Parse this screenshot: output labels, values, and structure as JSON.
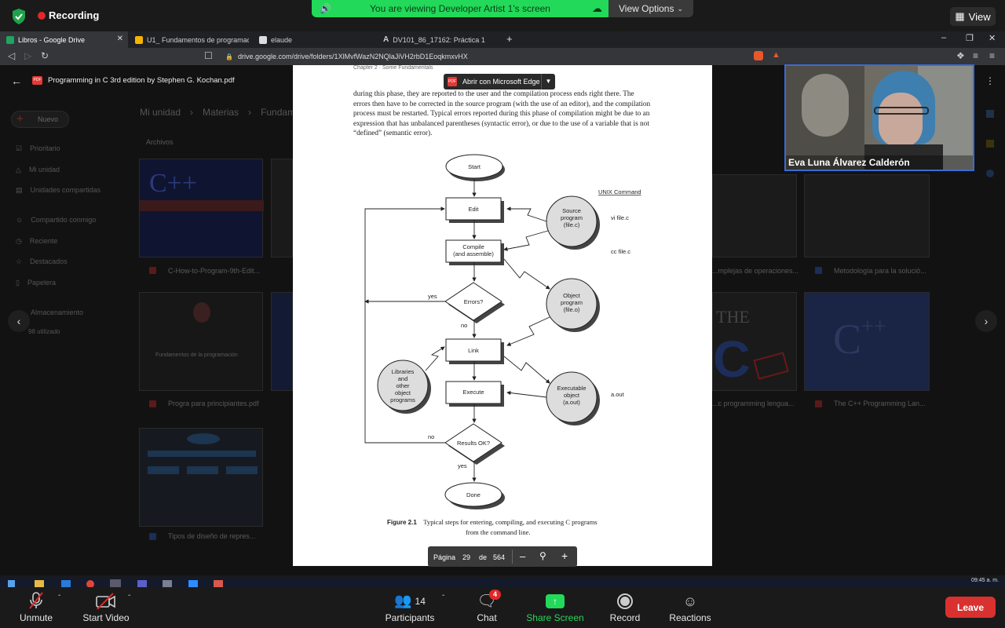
{
  "zoom": {
    "recording_label": "Recording",
    "viewing_text": "You are viewing Developer Artist 1's screen",
    "view_options": "View Options",
    "view_button": "View",
    "participant_name": "Eva Luna Álvarez Calderón",
    "bottom": {
      "unmute": "Unmute",
      "start_video": "Start Video",
      "participants": "Participants",
      "participants_count": "14",
      "chat": "Chat",
      "chat_badge": "4",
      "share_screen": "Share Screen",
      "record": "Record",
      "reactions": "Reactions",
      "leave": "Leave"
    }
  },
  "browser": {
    "tabs": [
      {
        "label": "Libros - Google Drive"
      },
      {
        "label": "U1_ Fundamentos de programación.p"
      },
      {
        "label": "elaude"
      },
      {
        "label": "DV101_86_17162: Práctica 1"
      }
    ],
    "url": "drive.google.com/drive/folders/1XlMvfWazN2NQlaJiVH2rbD1EoqkmxvHX"
  },
  "drive": {
    "file_title": "Programming in C 3rd edition by Stephen G. Kochan.pdf",
    "new_button": "Nuevo",
    "nav": [
      "Prioritario",
      "Mi unidad",
      "Unidades compartidas",
      "Compartido conmigo",
      "Reciente",
      "Destacados",
      "Papelera",
      "Almacenamiento"
    ],
    "storage": "98 utilizado",
    "breadcrumb": [
      "Mi unidad",
      "Materias",
      "Fundam"
    ],
    "section": "Archivos",
    "files": [
      "C-How-to-Program-9th-Edit...",
      "Fundamentos de la programación",
      "Progra para principiantes.pdf",
      "Tipos de diseño de repres...",
      "...mplejas de operaciones...",
      "Metodología para la solució...",
      "...c programming lengua...",
      "The C++ Programming Lan..."
    ],
    "open_with": "Abrir con Microsoft Edge"
  },
  "pdf": {
    "header": "Chapter 2 · Some Fundamentals",
    "paragraph": "during this phase, they are reported to the user and the compilation process ends right there. The errors then have to be corrected in the source program (with the use of an editor), and the compilation process must be restarted. Typical errors reported during this phase of compilation might be due to an expression that has unbalanced parentheses (syntactic error), or due to the use of a variable that is not “defined” (semantic error).",
    "flow": {
      "start": "Start",
      "edit": "Edit",
      "compile1": "Compile",
      "compile2": "(and assemble)",
      "errors": "Errors?",
      "yes": "yes",
      "no": "no",
      "link": "Link",
      "execute": "Execute",
      "results": "Results OK?",
      "no2": "no",
      "yes2": "yes",
      "done": "Done",
      "source": [
        "Source",
        "program",
        "(file.c)"
      ],
      "object": [
        "Object",
        "program",
        "(file.o)"
      ],
      "executable": [
        "Executable",
        "object",
        "(a.out)"
      ],
      "libraries": [
        "Libraries",
        "and",
        "other",
        "object",
        "programs"
      ],
      "unix_header": "UNIX Command",
      "cmd1": "vi file.c",
      "cmd2": "cc file.c",
      "cmd3": "a.out"
    },
    "caption_label": "Figure 2.1",
    "caption_line1": "Typical steps for entering, compiling, and executing C programs",
    "caption_line2": "from the command line.",
    "page_label": "Página",
    "page_current": "29",
    "page_of": "de",
    "page_total": "564"
  },
  "taskbar": {
    "time": "09:45 a. m."
  }
}
